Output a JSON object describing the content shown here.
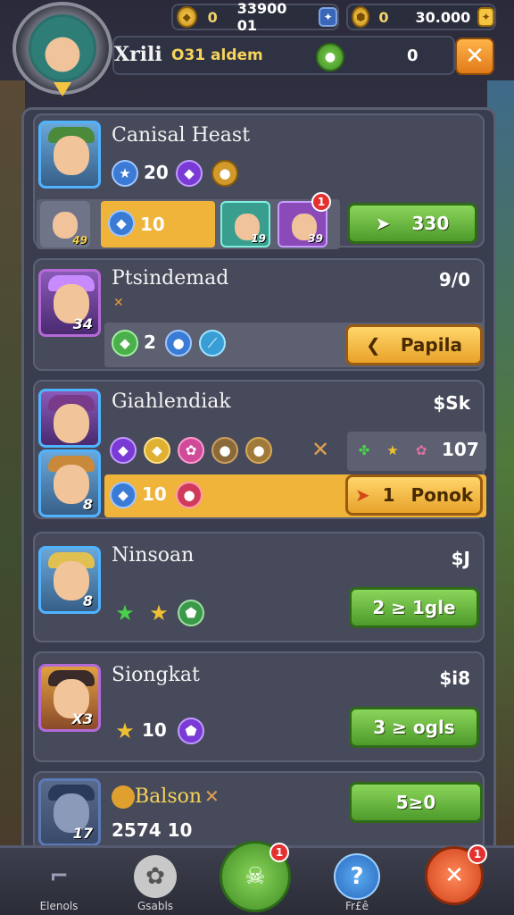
{
  "header": {
    "currency_left": {
      "icon": "gold-gem-icon",
      "count": "0",
      "amount": "33900 01",
      "add_icon": "blue-plus-icon"
    },
    "currency_right": {
      "icon": "gold-coin-icon",
      "count": "0",
      "amount": "30.000",
      "add_icon": "gold-plus-icon"
    },
    "player_name": "Xrili",
    "player_subtitle": "O31 aldem",
    "name_value": "0",
    "close_label": "✕"
  },
  "panel": {
    "close_label": "✕",
    "cards": [
      {
        "title": "Canisal Heast",
        "portrait_level": "",
        "stats": [
          {
            "icon": "blue-star-icon",
            "value": "20"
          },
          {
            "icon": "purple-gem-icon"
          },
          {
            "icon": "gold-medal-icon"
          }
        ],
        "team": [
          {
            "level": "49"
          },
          {
            "icon": "blue-gem-icon",
            "value": "10"
          },
          {
            "level": "19"
          },
          {
            "level": "39",
            "badge": "1"
          }
        ],
        "button_label": "330"
      },
      {
        "title": "Ptsindemad",
        "price": "9/0",
        "portrait_level": "34",
        "stats": [
          {
            "icon": "green-gem-icon",
            "value": "2"
          },
          {
            "icon": "blue-orb-icon"
          },
          {
            "icon": "blue-sword-icon"
          }
        ],
        "button_label": "Papila"
      },
      {
        "title": "Giahlendiak",
        "price": "$Sk",
        "portrait_level": "8",
        "items": [
          "purple-gem-icon",
          "gold-gem-icon",
          "pink-flower-icon",
          "bronze-orb-icon",
          "bronze-coin-icon",
          "crossed-swords-icon"
        ],
        "rewards": {
          "value": "107"
        },
        "stats": [
          {
            "icon": "blue-gem-icon",
            "value": "10"
          },
          {
            "icon": "red-orb-icon"
          }
        ],
        "button_number": "1",
        "button_label": "Ponok"
      },
      {
        "title": "Ninsoan",
        "price": "$J",
        "portrait_level": "8",
        "stats": [
          {
            "icon": "green-star-icon"
          },
          {
            "icon": "gold-star-icon"
          },
          {
            "icon": "green-potion-icon"
          }
        ],
        "button_label": "2 ≥ 1gle"
      },
      {
        "title": "Siongkat",
        "price": "$i8",
        "portrait_level": "X3",
        "stats": [
          {
            "icon": "gold-star-icon",
            "value": "10"
          },
          {
            "icon": "purple-potion-icon"
          }
        ],
        "button_label": "3 ≥ ogls"
      },
      {
        "title": "Balson",
        "portrait_level": "17",
        "subtitle": "2574 10",
        "button_label": "5≥0"
      }
    ]
  },
  "bottom_nav": [
    {
      "label": "Elenols",
      "icon": "boot-icon"
    },
    {
      "label": "Gsabls",
      "icon": "pet-icon"
    },
    {
      "label": "",
      "icon": "skull-icon",
      "badge": "1"
    },
    {
      "label": "Fr£ê",
      "icon": "question-icon"
    },
    {
      "label": "",
      "icon": "close-icon",
      "badge": "1"
    }
  ],
  "colors": {
    "accent_green": "#6fc244",
    "accent_orange": "#f0a830",
    "panel_bg": "#3a3d4d"
  }
}
